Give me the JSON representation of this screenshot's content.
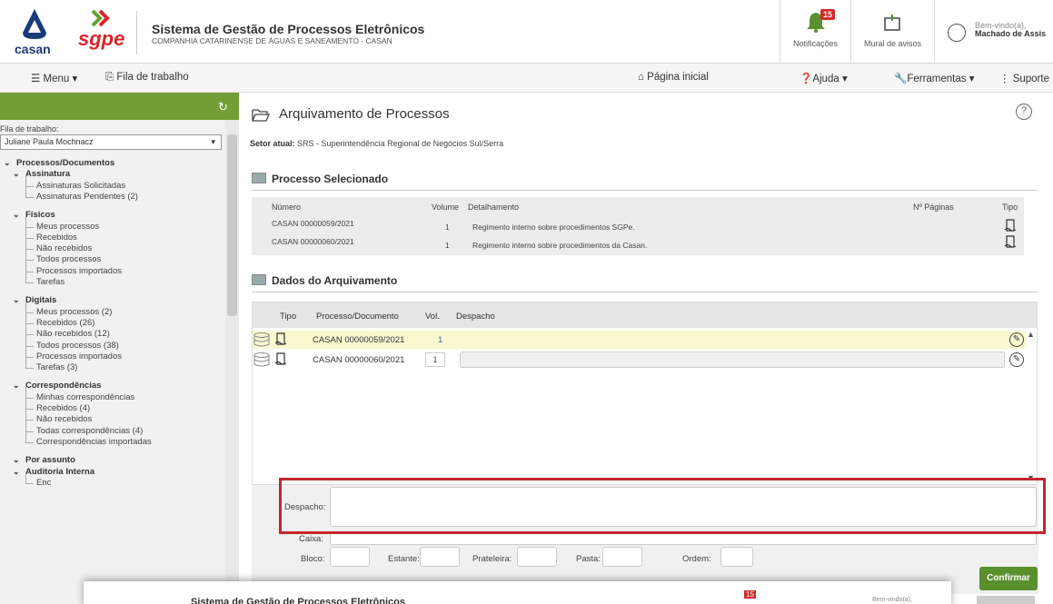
{
  "header": {
    "logo_casan_text": "casan",
    "logo_sgpe_text": "sgpe",
    "system_title": "Sistema de Gestão de Processos Eletrônicos",
    "company_name": "COMPANHIA CATARINENSE DE ÁGUAS E SANEAMENTO - CASAN",
    "notifications_label": "Notificações",
    "notifications_count": "15",
    "mural_label": "Mural de avisos",
    "user_greeting": "Bem-vindo(a),",
    "user_name": "Machado de Assis"
  },
  "navbar": {
    "menu": "Menu",
    "fila": "Fila de trabalho",
    "home": "Página inicial",
    "help": "Ajuda",
    "tools": "Ferramentas",
    "support": "Suporte"
  },
  "sidebar": {
    "fila_label": "Fila de trabalho:",
    "fila_value": "Juliane Paula Mochnacz",
    "tree": [
      {
        "kind": "h1",
        "label": "Processos/Documentos"
      },
      {
        "kind": "h2",
        "label": "Assinatura"
      },
      {
        "kind": "lf",
        "label": "Assinaturas Solicitadas"
      },
      {
        "kind": "lf",
        "label": "Assinaturas Pendentes (2)"
      },
      {
        "kind": "h2",
        "label": "Físicos"
      },
      {
        "kind": "lf",
        "label": "Meus processos"
      },
      {
        "kind": "lf",
        "label": "Recebidos"
      },
      {
        "kind": "lf",
        "label": "Não recebidos"
      },
      {
        "kind": "lf",
        "label": "Todos processos"
      },
      {
        "kind": "lf",
        "label": "Processos importados"
      },
      {
        "kind": "lf",
        "label": "Tarefas"
      },
      {
        "kind": "h2",
        "label": "Digitais"
      },
      {
        "kind": "lf",
        "label": "Meus processos (2)"
      },
      {
        "kind": "lf",
        "label": "Recebidos (26)"
      },
      {
        "kind": "lf",
        "label": "Não recebidos (12)"
      },
      {
        "kind": "lf",
        "label": "Todos processos (38)"
      },
      {
        "kind": "lf",
        "label": "Processos importados"
      },
      {
        "kind": "lf",
        "label": "Tarefas (3)"
      },
      {
        "kind": "h2",
        "label": "Correspondências"
      },
      {
        "kind": "lf",
        "label": "Minhas correspondências"
      },
      {
        "kind": "lf",
        "label": "Recebidos (4)"
      },
      {
        "kind": "lf",
        "label": "Não recebidos"
      },
      {
        "kind": "lf",
        "label": "Todas correspondências (4)"
      },
      {
        "kind": "lf",
        "label": "Correspondências importadas"
      },
      {
        "kind": "h2",
        "label": "Por assunto"
      },
      {
        "kind": "h2",
        "label": "Auditoria Interna"
      },
      {
        "kind": "lf",
        "label": "Enc"
      }
    ]
  },
  "main": {
    "title": "Arquivamento de Processos",
    "setor_label": "Setor atual:",
    "setor_value": "SRS - Superintendência Regional de Negócios Sul/Serra",
    "selected_title": "Processo Selecionado",
    "selected_cols": [
      "Número",
      "Volume",
      "Detalhamento",
      "Nº Páginas",
      "Tipo"
    ],
    "selected_rows": [
      {
        "numero": "CASAN 00000059/2021",
        "volume": "1",
        "detalhamento": "Regimento interno sobre procedimentos SGPe."
      },
      {
        "numero": "CASAN 00000060/2021",
        "volume": "1",
        "detalhamento": "Regimento interno sobre procedimentos da Casan."
      }
    ],
    "dados_title": "Dados do Arquivamento",
    "grid_cols": [
      "Tipo",
      "Processo/Documento",
      "Vol.",
      "Despacho"
    ],
    "grid_rows": [
      {
        "processo": "CASAN 00000059/2021",
        "vol": "1"
      },
      {
        "processo": "CASAN 00000060/2021",
        "vol": "1"
      }
    ],
    "form": {
      "despacho": "Despacho:",
      "caixa": "Caixa:",
      "bloco": "Bloco:",
      "estante": "Estante:",
      "prateleira": "Prateleira:",
      "pasta": "Pasta:",
      "ordem": "Ordem:"
    },
    "confirm": "Confirmar"
  },
  "overlay": {
    "title": "Sistema de Gestão de Processos Eletrônicos",
    "count": "15",
    "greeting": "Bem-vindo(a),"
  },
  "colors": {
    "accent_green": "#739e37",
    "badge_red": "#d42a2a",
    "highlight_red": "#c1272d"
  }
}
